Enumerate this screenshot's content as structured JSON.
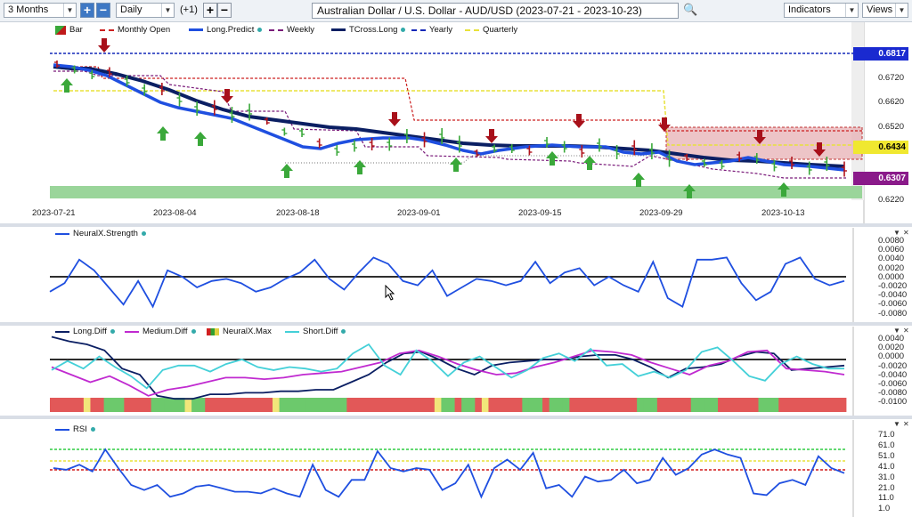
{
  "toolbar": {
    "range_select": "3 Months",
    "interval_select": "Daily",
    "offset_label": "(+1)",
    "symbol_title": "Australian Dollar / U.S. Dollar - AUD/USD (2023-07-21 - 2023-10-23)",
    "indicators_label": "Indicators",
    "views_label": "Views",
    "plus_glyph": "+",
    "minus_glyph": "−",
    "search_glyph": "🔍",
    "dropdown_glyph": "▼"
  },
  "main_legend": {
    "bar": "Bar",
    "monthly_open": "Monthly Open",
    "long_predict": "Long.Predict",
    "weekly": "Weekly",
    "tcross_long": "TCross.Long",
    "yearly": "Yearly",
    "quarterly": "Quarterly"
  },
  "price_axis": [
    "0.6720",
    "0.6620",
    "0.6520",
    "0.6220"
  ],
  "price_boxes": {
    "yearly": "0.6817",
    "quarterly": "0.6434",
    "last": "0.6307"
  },
  "date_axis": [
    "2023-07-21",
    "2023-08-04",
    "2023-08-18",
    "2023-09-01",
    "2023-09-15",
    "2023-09-29",
    "2023-10-13"
  ],
  "strength_panel": {
    "legend": "NeuralX.Strength",
    "axis": [
      "0.0080",
      "0.0060",
      "0.0040",
      "0.0020",
      "0.0000",
      "-0.0020",
      "-0.0040",
      "-0.0060",
      "-0.0080"
    ]
  },
  "diff_panel": {
    "legend": [
      "Long.Diff",
      "Medium.Diff",
      "NeuralX.Max",
      "Short.Diff"
    ],
    "axis": [
      "0.0040",
      "0.0020",
      "0.0000",
      "-0.0020",
      "-0.0040",
      "-0.0060",
      "-0.0080",
      "-0.0100"
    ]
  },
  "rsi_panel": {
    "legend": "RSI",
    "axis": [
      "71.0",
      "61.0",
      "51.0",
      "41.0",
      "31.0",
      "21.0",
      "11.0",
      "1.0"
    ]
  },
  "colors": {
    "blue_line": "#1f4fe0",
    "navy_line": "#0b1f63",
    "monthly_red": "#cc1f1f",
    "weekly_purple": "#7a1a7a",
    "yearly_blue": "#1428b8",
    "quarterly_yellow": "#e8e23a",
    "bull_green": "#3aa83a",
    "bear_red": "#b0141c",
    "band_green": "#9ad59a",
    "cyan": "#44d0d8",
    "magenta": "#c02ad0"
  }
}
